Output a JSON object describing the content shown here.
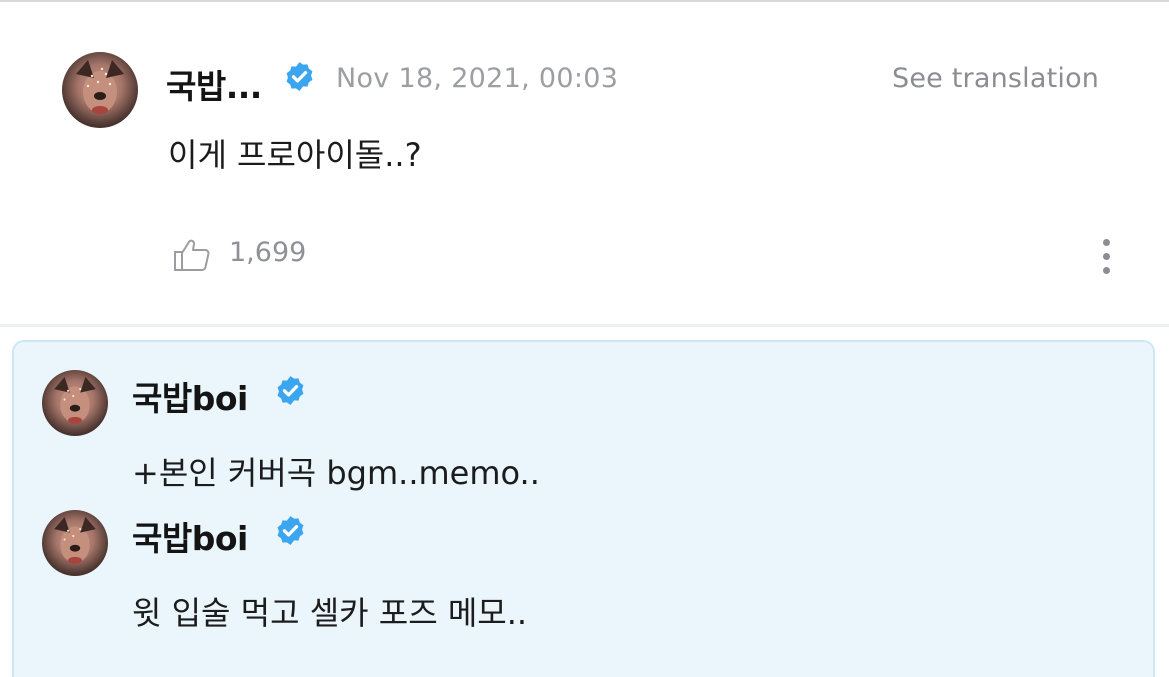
{
  "post": {
    "author": "국밥...",
    "timestamp": "Nov 18, 2021, 00:03",
    "see_translation": "See translation",
    "text": "이게 프로아이돌..?",
    "like_count": "1,699"
  },
  "replies": [
    {
      "author": "국밥boi",
      "text": "+본인 커버곡 bgm..memo.."
    },
    {
      "author": "국밥boi",
      "text": "윗 입술 먹고 셀카 포즈 메모.."
    }
  ],
  "colors": {
    "verified_badge": "#3ba5f0",
    "reply_background": "#eaf6fc",
    "muted_text": "#9b9ea3"
  }
}
